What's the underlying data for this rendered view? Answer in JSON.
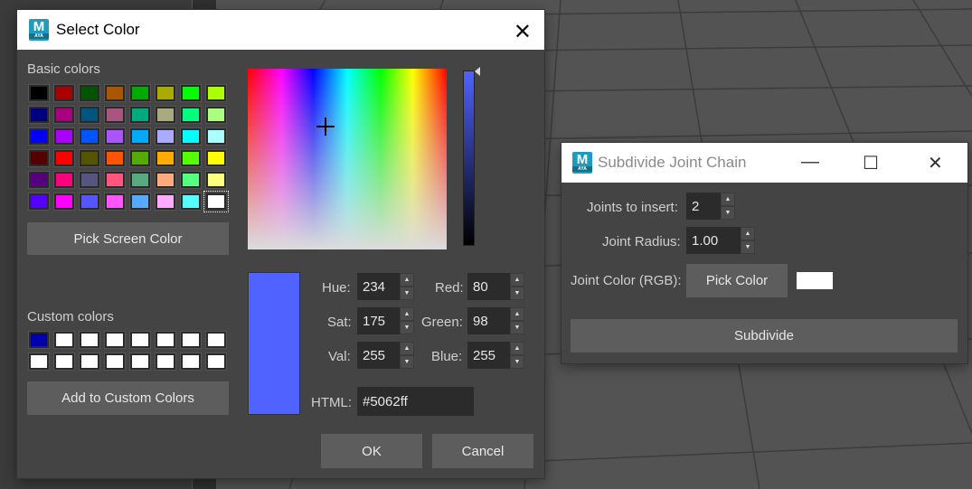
{
  "color_dialog": {
    "title": "Select Color",
    "app_icon": {
      "letter": "M",
      "sub": "AYA"
    },
    "close_glyph": "✕",
    "basic_colors_label": "Basic colors",
    "basic_colors": [
      [
        "#000000",
        "#aa0000",
        "#005500",
        "#aa5500",
        "#00aa00",
        "#aaaa00",
        "#00ff00",
        "#aaff00"
      ],
      [
        "#00007f",
        "#aa007f",
        "#00557f",
        "#aa557f",
        "#00aa7f",
        "#aaaa7f",
        "#00ff7f",
        "#aaff7f"
      ],
      [
        "#0000ff",
        "#aa00ff",
        "#0055ff",
        "#aa55ff",
        "#00aaff",
        "#aaaaff",
        "#00ffff",
        "#aaffff"
      ],
      [
        "#550000",
        "#ff0000",
        "#555500",
        "#ff5500",
        "#55aa00",
        "#ffaa00",
        "#55ff00",
        "#ffff00"
      ],
      [
        "#55007f",
        "#ff007f",
        "#55557f",
        "#ff557f",
        "#55aa7f",
        "#ffaa7f",
        "#55ff7f",
        "#ffff7f"
      ],
      [
        "#5500ff",
        "#ff00ff",
        "#5555ff",
        "#ff55ff",
        "#55aaff",
        "#ffaaff",
        "#55ffff",
        "#ffffff"
      ]
    ],
    "pick_screen_label": "Pick Screen Color",
    "custom_colors_label": "Custom colors",
    "custom_colors": [
      [
        "#0000aa",
        "#ffffff",
        "#ffffff",
        "#ffffff",
        "#ffffff",
        "#ffffff",
        "#ffffff",
        "#ffffff"
      ],
      [
        "#ffffff",
        "#ffffff",
        "#ffffff",
        "#ffffff",
        "#ffffff",
        "#ffffff",
        "#ffffff",
        "#ffffff"
      ]
    ],
    "add_custom_label": "Add to Custom Colors",
    "current_color": "#5062ff",
    "hue": {
      "label": "Hue:",
      "value": "234"
    },
    "sat": {
      "label": "Sat:",
      "value": "175"
    },
    "val": {
      "label": "Val:",
      "value": "255"
    },
    "red": {
      "label": "Red:",
      "value": "80"
    },
    "green": {
      "label": "Green:",
      "value": "98"
    },
    "blue": {
      "label": "Blue:",
      "value": "255"
    },
    "html": {
      "label": "HTML:",
      "value": "#5062ff"
    },
    "ok_label": "OK",
    "cancel_label": "Cancel"
  },
  "joint_window": {
    "title": "Subdivide Joint Chain",
    "app_icon": {
      "letter": "M",
      "sub": "AYA"
    },
    "controls": {
      "minimize": "—",
      "maximize": "☐",
      "close": "✕"
    },
    "joints_label": "Joints to insert:",
    "joints_value": "2",
    "radius_label": "Joint Radius:",
    "radius_value": "1.00",
    "color_label": "Joint Color (RGB):",
    "pick_color_label": "Pick Color",
    "color_swatch": "#ffffff",
    "subdivide_label": "Subdivide"
  },
  "spinner_arrows": {
    "up": "▲",
    "down": "▼"
  }
}
